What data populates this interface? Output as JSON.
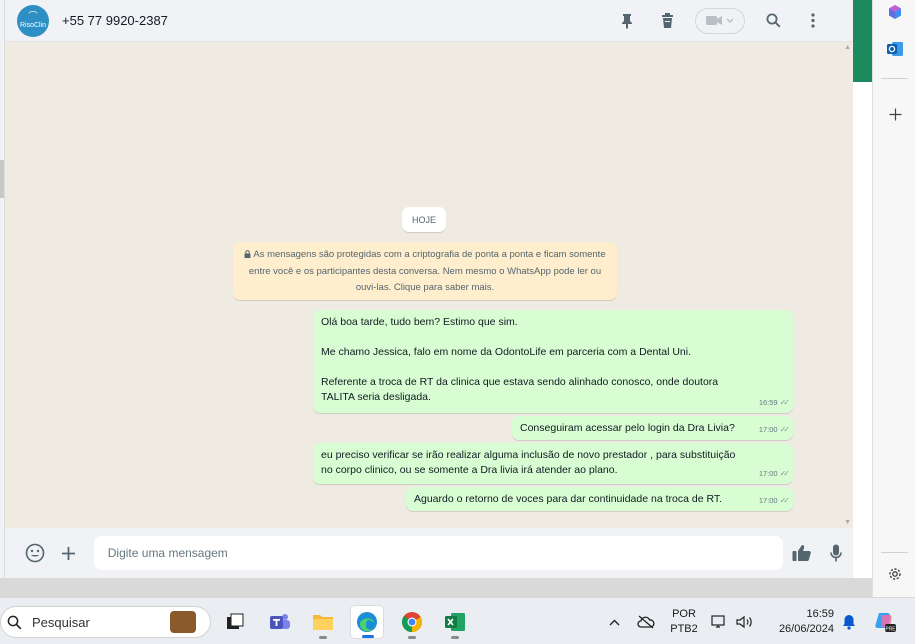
{
  "header": {
    "avatar_text": "RisoClin",
    "contact_name": "+55 77 9920-2387",
    "icons": [
      "pin-icon",
      "delete-icon",
      "video-call-icon",
      "search-icon",
      "menu-icon"
    ]
  },
  "chat": {
    "date_chip": "HOJE",
    "encryption_notice": "As mensagens são protegidas com a criptografia de ponta a ponta e ficam somente entre você e os participantes desta conversa. Nem mesmo o WhatsApp pode ler ou ouvi-las. Clique para saber mais.",
    "messages": [
      {
        "paragraphs": [
          "Olá boa tarde, tudo bem? Estimo que sim.",
          "Me chamo Jessica, falo em nome da OdontoLife em parceria com a Dental Uni.",
          "Referente a troca de RT da clinica que estava sendo alinhado conosco, onde doutora TALITA seria desligada."
        ],
        "time": "16:59"
      },
      {
        "text": "Conseguiram acessar pelo login da Dra Livia?",
        "time": "17:00"
      },
      {
        "text": "eu preciso verificar se irão realizar alguma inclusão de novo prestador , para substituição no corpo clinico, ou se somente a Dra livia irá atender ao plano.",
        "time": "17:00"
      },
      {
        "text": "Aguardo o retorno de voces para dar continuidade na troca de RT.",
        "time": "17:00"
      }
    ]
  },
  "composer": {
    "placeholder": "Digite uma mensagem"
  },
  "taskbar": {
    "search_label": "Pesquisar",
    "language_top": "POR",
    "language_bottom": "PTB2",
    "time": "16:59",
    "date": "26/06/2024"
  },
  "colors": {
    "outgoing_bubble": "#d9fdd3",
    "notice_bubble": "#ffeecd",
    "chat_background": "#efeae2",
    "accent_green": "#1d8a5e"
  }
}
